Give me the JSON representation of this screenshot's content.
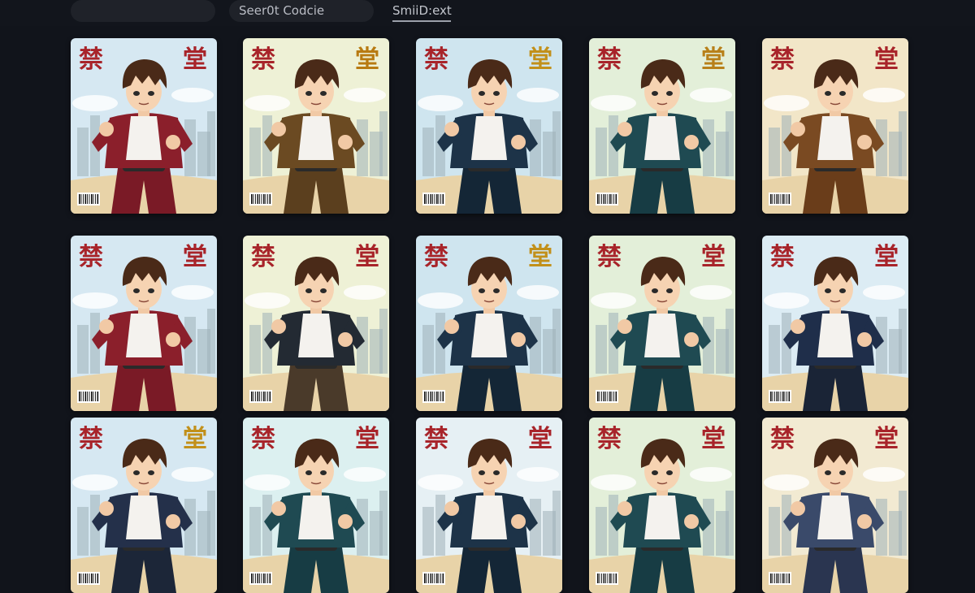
{
  "toolbar": {
    "search_text": "Seer0t Codcie",
    "tab_label": "SmiiD:ext"
  },
  "card_common": {
    "kanji_left": "禁",
    "kanji_right": "堂",
    "kanji_color": "#a8242a",
    "icon": "barcode-icon"
  },
  "cards": [
    {
      "jacket": "#8b1f2b",
      "pants": "#7a1a26",
      "sky": "#d6e8f2",
      "kanji_right_color": "#a8242a"
    },
    {
      "jacket": "#6b4a22",
      "pants": "#5b3f1e",
      "sky": "#eef1d6",
      "kanji_right_color": "#b87a12"
    },
    {
      "jacket": "#1d3348",
      "pants": "#142636",
      "sky": "#cfe5ef",
      "kanji_right_color": "#c2901a"
    },
    {
      "jacket": "#1f4a52",
      "pants": "#173c44",
      "sky": "#e3efd9",
      "kanji_right_color": "#b8801a"
    },
    {
      "jacket": "#7a4a22",
      "pants": "#6a3d1a",
      "sky": "#f2e6c8",
      "kanji_right_color": "#a8242a"
    },
    {
      "jacket": "#8b1f2b",
      "pants": "#7a1a26",
      "sky": "#d6e8f2",
      "kanji_right_color": "#a8242a"
    },
    {
      "jacket": "#232a33",
      "pants": "#4a3a2a",
      "sky": "#eef1d6",
      "kanji_right_color": "#a8242a"
    },
    {
      "jacket": "#1d3348",
      "pants": "#142636",
      "sky": "#cfe5ef",
      "kanji_right_color": "#c2901a"
    },
    {
      "jacket": "#1f4a52",
      "pants": "#173c44",
      "sky": "#e3efd9",
      "kanji_right_color": "#a8242a"
    },
    {
      "jacket": "#1f2e4a",
      "pants": "#1a2436",
      "sky": "#dcecf4",
      "kanji_right_color": "#a8242a"
    },
    {
      "jacket": "#24304a",
      "pants": "#1c2638",
      "sky": "#d6e8f2",
      "kanji_right_color": "#c2901a"
    },
    {
      "jacket": "#1f4a52",
      "pants": "#173c44",
      "sky": "#dcf0f0",
      "kanji_right_color": "#a8242a"
    },
    {
      "jacket": "#1d3348",
      "pants": "#142636",
      "sky": "#e6f0f4",
      "kanji_right_color": "#a8242a"
    },
    {
      "jacket": "#1f4a52",
      "pants": "#173c44",
      "sky": "#e3efd9",
      "kanji_right_color": "#a8242a"
    },
    {
      "jacket": "#3a4a6a",
      "pants": "#2a3550",
      "sky": "#f2ead2",
      "kanji_right_color": "#a8242a"
    }
  ]
}
